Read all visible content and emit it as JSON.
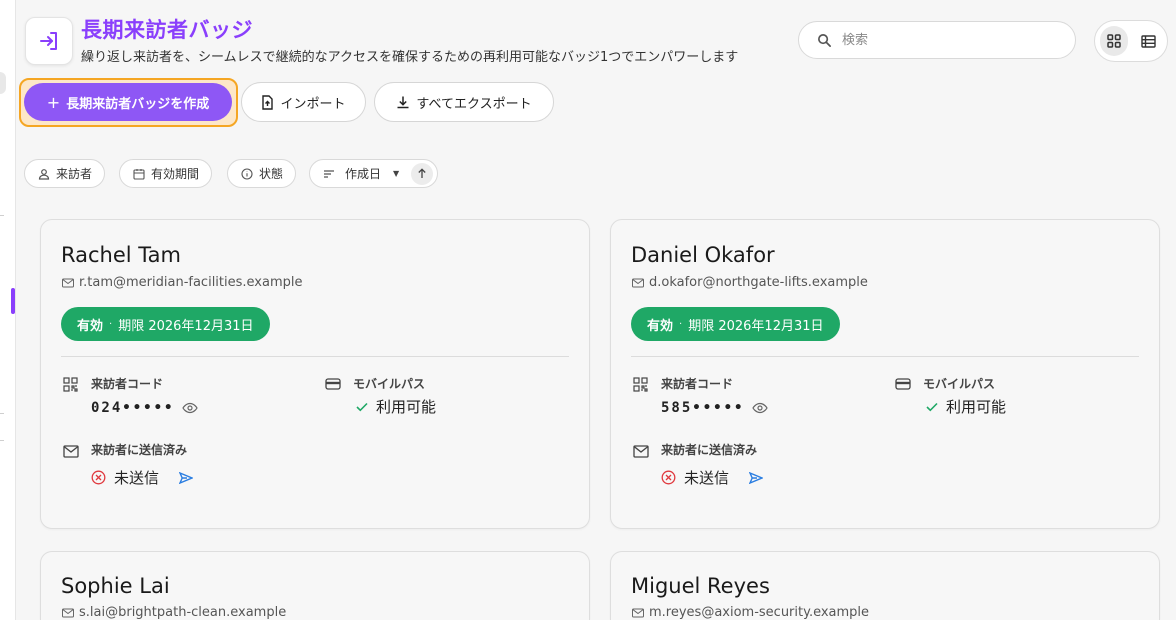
{
  "header": {
    "title": "長期来訪者バッジ",
    "subtitle": "繰り返し来訪者を、シームレスで継続的なアクセスを確保するための再利用可能なバッジ1つでエンパワーします"
  },
  "search": {
    "placeholder": "検索"
  },
  "toolbar": {
    "create_label": "長期来訪者バッジを作成",
    "import_label": "インポート",
    "export_label": "すべてエクスポート"
  },
  "filters": {
    "visitor": "来訪者",
    "validity": "有効期間",
    "status": "状態",
    "sort": "作成日"
  },
  "labels": {
    "visitor_code": "来訪者コード",
    "mobile_pass": "モバイルパス",
    "sent_to_visitor": "来訪者に送信済み"
  },
  "colors": {
    "accent": "#8a3ffc",
    "active": "#1fa866",
    "error": "#e0393e",
    "send": "#2a7de1"
  },
  "cards": [
    {
      "name": "Rachel Tam",
      "email": "r.tam@meridian-facilities.example",
      "status": "有効",
      "expiry": "期限 2026年12月31日",
      "code": "024•••••",
      "mobile": "利用可能",
      "sent": "未送信"
    },
    {
      "name": "Daniel Okafor",
      "email": "d.okafor@northgate-lifts.example",
      "status": "有効",
      "expiry": "期限 2026年12月31日",
      "code": "585•••••",
      "mobile": "利用可能",
      "sent": "未送信"
    },
    {
      "name": "Sophie Lai",
      "email": "s.lai@brightpath-clean.example"
    },
    {
      "name": "Miguel Reyes",
      "email": "m.reyes@axiom-security.example"
    }
  ]
}
